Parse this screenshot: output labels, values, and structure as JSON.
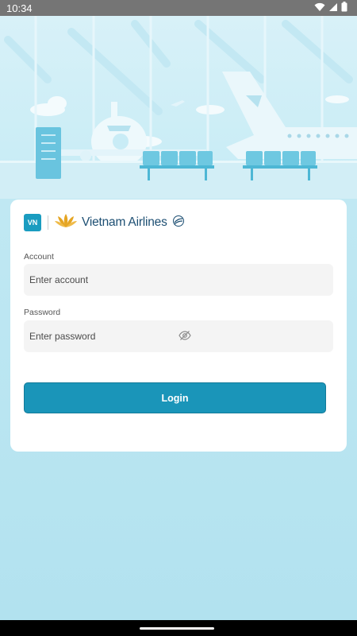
{
  "status_bar": {
    "time": "10:34"
  },
  "brand": {
    "app_logo_text": "VN",
    "airline_name": "Vietnam Airlines"
  },
  "form": {
    "account_label": "Account",
    "account_placeholder": "Enter account",
    "password_label": "Password",
    "password_placeholder": "Enter password",
    "login_label": "Login"
  },
  "icons": {
    "wifi": "wifi-icon",
    "signal": "signal-icon",
    "battery": "battery-icon",
    "password_toggle": "eye-off-icon"
  },
  "colors": {
    "accent": "#1a95b9",
    "brand_text": "#1d4f73",
    "lotus_gold": "#e5a523",
    "background": "#b5e3f0"
  }
}
